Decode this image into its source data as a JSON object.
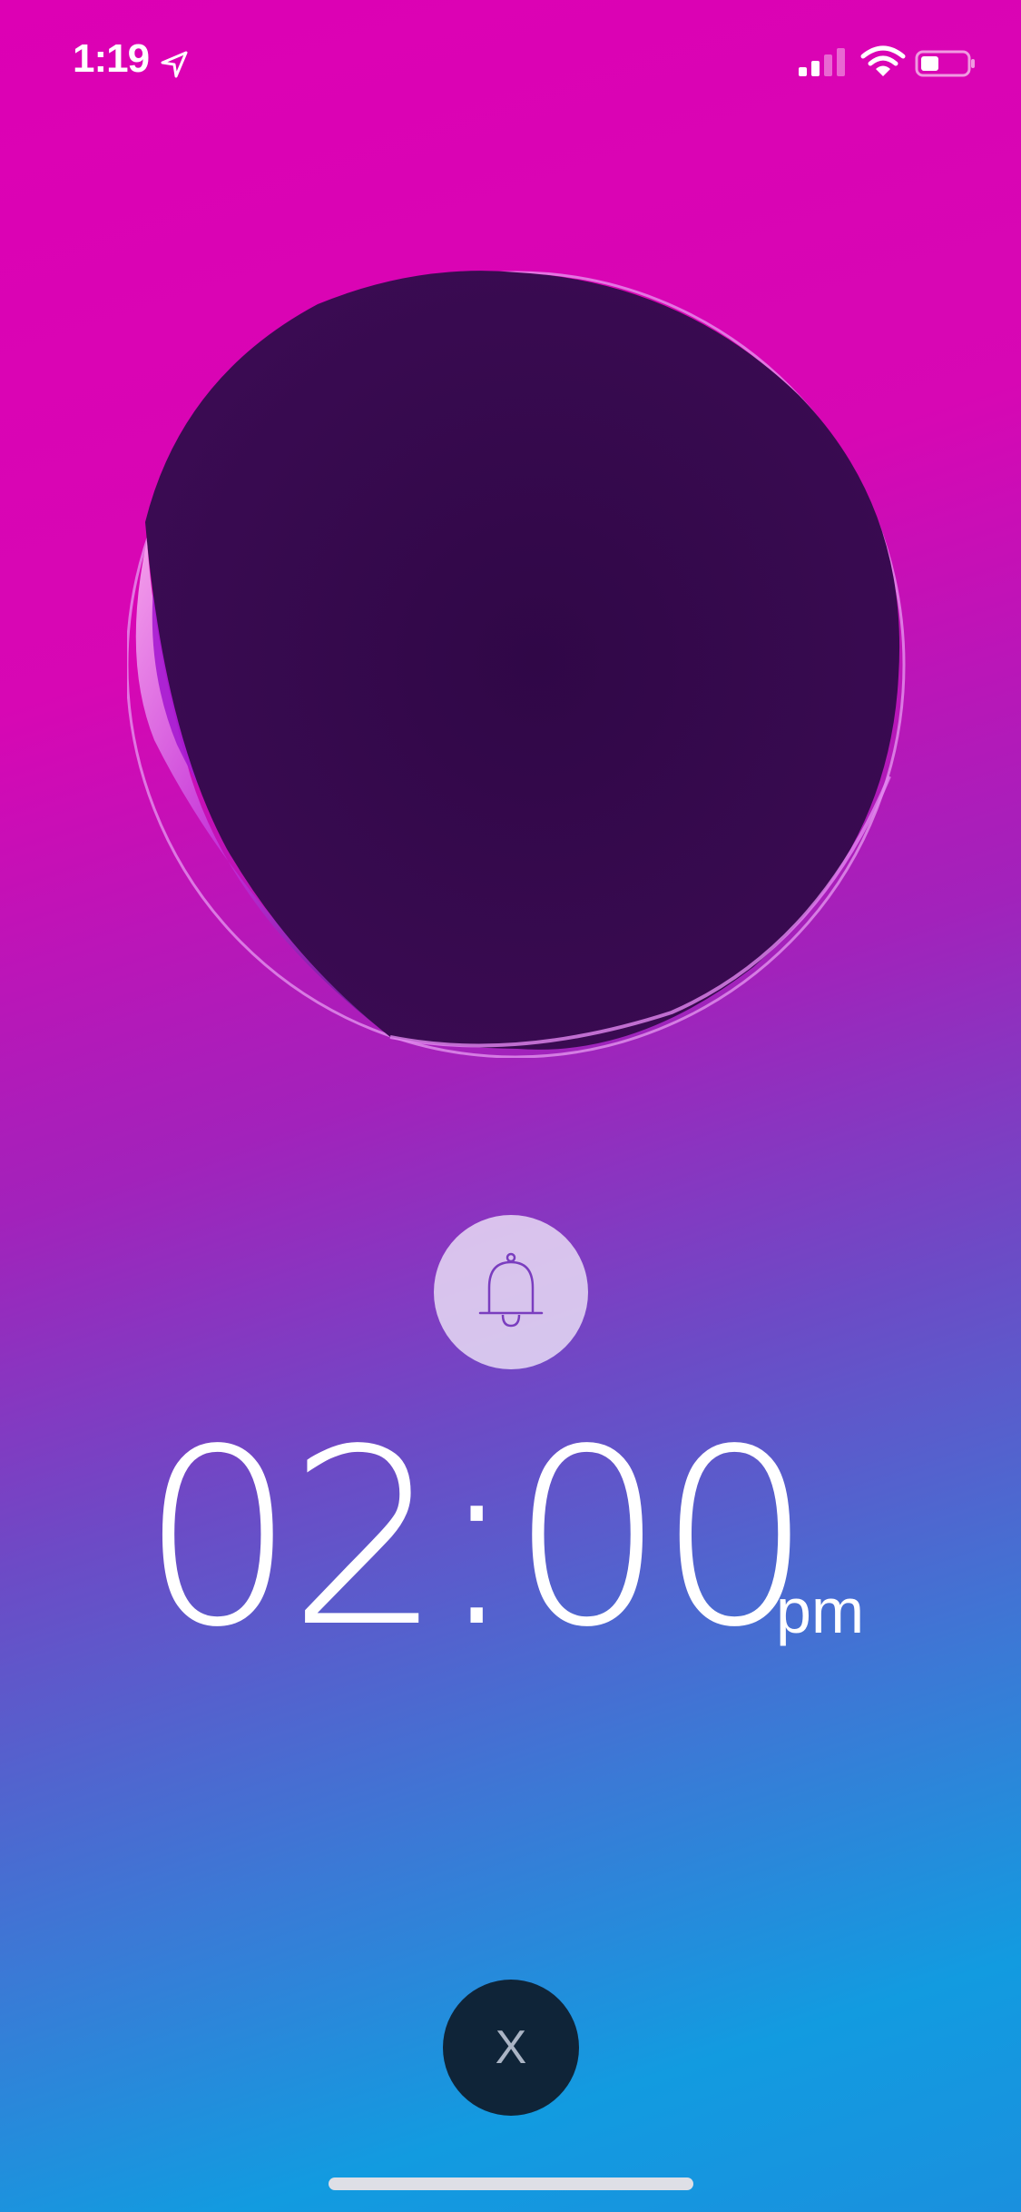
{
  "status_bar": {
    "time": "1:19",
    "location_icon": "location-arrow-icon",
    "signal_icon": "cellular-signal-icon",
    "wifi_icon": "wifi-icon",
    "battery_icon": "battery-icon",
    "battery_level": 0.4
  },
  "alarm": {
    "bell_icon": "bell-icon",
    "time": "02:00",
    "meridiem": "pm"
  },
  "dismiss": {
    "label": "X"
  },
  "colors": {
    "background_top": "#dd00b4",
    "background_bottom": "#129be0",
    "disc": "#330a4d",
    "dismiss_button": "#0f2438"
  }
}
